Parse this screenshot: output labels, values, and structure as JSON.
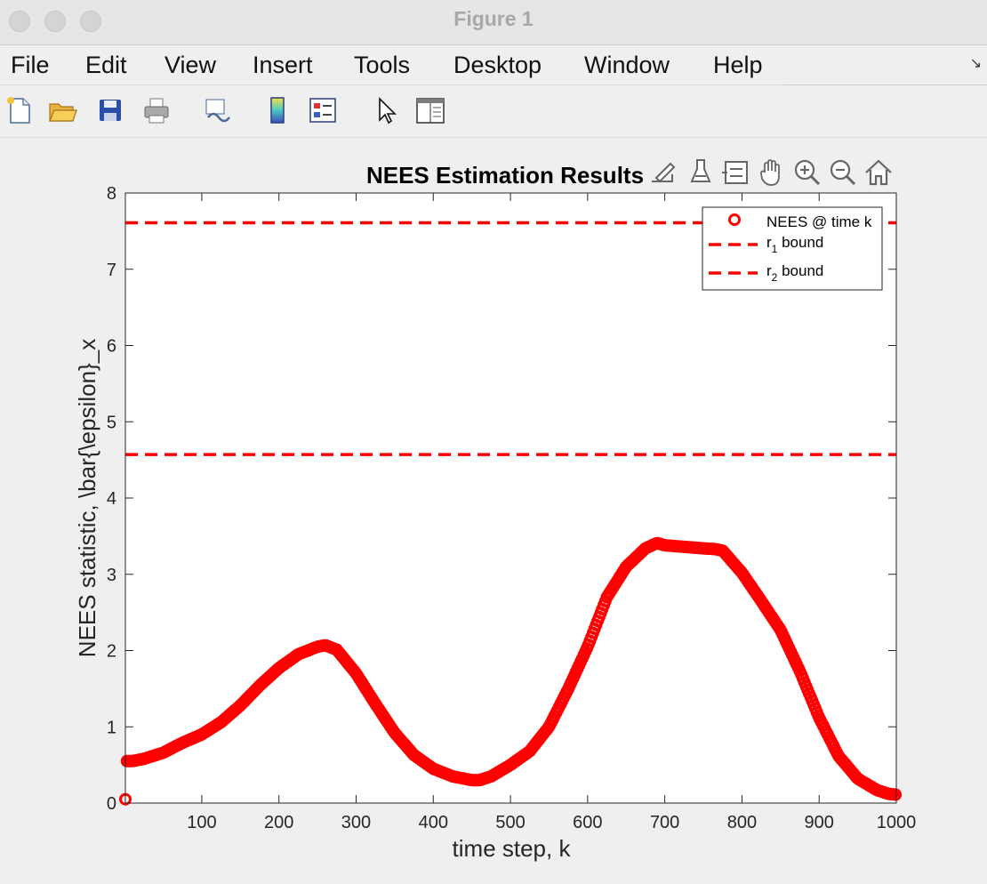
{
  "window": {
    "title": "Figure 1"
  },
  "menu": [
    "File",
    "Edit",
    "View",
    "Insert",
    "Tools",
    "Desktop",
    "Window",
    "Help"
  ],
  "toolbar": {
    "buttons": [
      "new-figure",
      "open-file",
      "save",
      "print",
      "link-plot",
      "insert-colorbar",
      "insert-legend",
      "edit-plot",
      "property-inspector"
    ]
  },
  "axes_toolbar": [
    "export",
    "brush",
    "data-tips",
    "pan",
    "zoom-in",
    "zoom-out",
    "restore-view"
  ],
  "colors": {
    "series": "#ff0000",
    "background": "#efefef",
    "axes_bg": "#ffffff"
  },
  "chart_data": {
    "type": "scatter",
    "title": "NEES Estimation Results",
    "xlabel": "time step, k",
    "ylabel": "NEES statistic, \\bar{\\epsilon}_x",
    "xlim": [
      1,
      1000
    ],
    "ylim": [
      0,
      8
    ],
    "xticks": [
      100,
      200,
      300,
      400,
      500,
      600,
      700,
      800,
      900,
      1000
    ],
    "yticks": [
      0,
      1,
      2,
      3,
      4,
      5,
      6,
      7,
      8
    ],
    "grid": false,
    "legend_position": "top-right",
    "legend": [
      {
        "label": "NEES @ time k",
        "style": "circle-marker"
      },
      {
        "label_base": "r",
        "label_sub": "1",
        "label_rest": " bound",
        "style": "dashed"
      },
      {
        "label_base": "r",
        "label_sub": "2",
        "label_rest": " bound",
        "style": "dashed"
      }
    ],
    "series": [
      {
        "name": "NEES @ time k",
        "marker": "circle",
        "color": "#ff0000",
        "x": [
          1,
          2,
          3,
          5,
          10,
          25,
          50,
          75,
          100,
          125,
          150,
          175,
          200,
          225,
          250,
          260,
          275,
          300,
          325,
          350,
          375,
          400,
          425,
          450,
          460,
          475,
          500,
          525,
          550,
          575,
          600,
          625,
          650,
          675,
          690,
          700,
          725,
          750,
          765,
          775,
          800,
          825,
          850,
          875,
          900,
          925,
          950,
          975,
          990,
          1000
        ],
        "y": [
          0.05,
          0.55,
          0.55,
          0.55,
          0.55,
          0.58,
          0.66,
          0.79,
          0.9,
          1.06,
          1.28,
          1.54,
          1.77,
          1.95,
          2.05,
          2.07,
          2.01,
          1.7,
          1.3,
          0.92,
          0.63,
          0.45,
          0.35,
          0.3,
          0.3,
          0.35,
          0.5,
          0.68,
          1.0,
          1.5,
          2.05,
          2.7,
          3.1,
          3.34,
          3.41,
          3.38,
          3.36,
          3.34,
          3.33,
          3.31,
          3.02,
          2.65,
          2.27,
          1.73,
          1.12,
          0.62,
          0.32,
          0.17,
          0.12,
          0.11
        ]
      },
      {
        "name": "r1 bound",
        "style": "dashed",
        "color": "#ff0000",
        "y_constant": 4.57
      },
      {
        "name": "r2 bound",
        "style": "dashed",
        "color": "#ff0000",
        "y_constant": 7.61
      }
    ]
  }
}
